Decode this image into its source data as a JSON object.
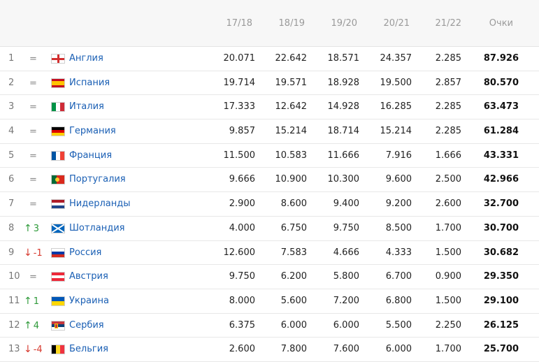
{
  "header": {
    "seasons": [
      "17/18",
      "18/19",
      "19/20",
      "20/21",
      "21/22"
    ],
    "points_label": "Очки"
  },
  "rows": [
    {
      "rank": "1",
      "arrow": "",
      "change": "=",
      "trend": "same",
      "flag": "england-flag-icon",
      "country": "Англия",
      "s1": "20.071",
      "s2": "22.642",
      "s3": "18.571",
      "s4": "24.357",
      "s5": "2.285",
      "total": "87.926"
    },
    {
      "rank": "2",
      "arrow": "",
      "change": "=",
      "trend": "same",
      "flag": "spain-flag-icon",
      "country": "Испания",
      "s1": "19.714",
      "s2": "19.571",
      "s3": "18.928",
      "s4": "19.500",
      "s5": "2.857",
      "total": "80.570"
    },
    {
      "rank": "3",
      "arrow": "",
      "change": "=",
      "trend": "same",
      "flag": "italy-flag-icon",
      "country": "Италия",
      "s1": "17.333",
      "s2": "12.642",
      "s3": "14.928",
      "s4": "16.285",
      "s5": "2.285",
      "total": "63.473"
    },
    {
      "rank": "4",
      "arrow": "",
      "change": "=",
      "trend": "same",
      "flag": "germany-flag-icon",
      "country": "Германия",
      "s1": "9.857",
      "s2": "15.214",
      "s3": "18.714",
      "s4": "15.214",
      "s5": "2.285",
      "total": "61.284"
    },
    {
      "rank": "5",
      "arrow": "",
      "change": "=",
      "trend": "same",
      "flag": "france-flag-icon",
      "country": "Франция",
      "s1": "11.500",
      "s2": "10.583",
      "s3": "11.666",
      "s4": "7.916",
      "s5": "1.666",
      "total": "43.331"
    },
    {
      "rank": "6",
      "arrow": "",
      "change": "=",
      "trend": "same",
      "flag": "portugal-flag-icon",
      "country": "Португалия",
      "s1": "9.666",
      "s2": "10.900",
      "s3": "10.300",
      "s4": "9.600",
      "s5": "2.500",
      "total": "42.966"
    },
    {
      "rank": "7",
      "arrow": "",
      "change": "=",
      "trend": "same",
      "flag": "netherlands-flag-icon",
      "country": "Нидерланды",
      "s1": "2.900",
      "s2": "8.600",
      "s3": "9.400",
      "s4": "9.200",
      "s5": "2.600",
      "total": "32.700"
    },
    {
      "rank": "8",
      "arrow": "↑",
      "change": "3",
      "trend": "up",
      "flag": "scotland-flag-icon",
      "country": "Шотландия",
      "s1": "4.000",
      "s2": "6.750",
      "s3": "9.750",
      "s4": "8.500",
      "s5": "1.700",
      "total": "30.700"
    },
    {
      "rank": "9",
      "arrow": "↓",
      "change": "-1",
      "trend": "down",
      "flag": "russia-flag-icon",
      "country": "Россия",
      "s1": "12.600",
      "s2": "7.583",
      "s3": "4.666",
      "s4": "4.333",
      "s5": "1.500",
      "total": "30.682"
    },
    {
      "rank": "10",
      "arrow": "",
      "change": "=",
      "trend": "same",
      "flag": "austria-flag-icon",
      "country": "Австрия",
      "s1": "9.750",
      "s2": "6.200",
      "s3": "5.800",
      "s4": "6.700",
      "s5": "0.900",
      "total": "29.350"
    },
    {
      "rank": "11",
      "arrow": "↑",
      "change": "1",
      "trend": "up",
      "flag": "ukraine-flag-icon",
      "country": "Украина",
      "s1": "8.000",
      "s2": "5.600",
      "s3": "7.200",
      "s4": "6.800",
      "s5": "1.500",
      "total": "29.100"
    },
    {
      "rank": "12",
      "arrow": "↑",
      "change": "4",
      "trend": "up",
      "flag": "serbia-flag-icon",
      "country": "Сербия",
      "s1": "6.375",
      "s2": "6.000",
      "s3": "6.000",
      "s4": "5.500",
      "s5": "2.250",
      "total": "26.125"
    },
    {
      "rank": "13",
      "arrow": "↓",
      "change": "-4",
      "trend": "down",
      "flag": "belgium-flag-icon",
      "country": "Бельгия",
      "s1": "2.600",
      "s2": "7.800",
      "s3": "7.600",
      "s4": "6.000",
      "s5": "1.700",
      "total": "25.700"
    }
  ],
  "colors": {
    "link": "#1a5fb4",
    "up": "#2f9a3a",
    "down": "#d73a2f",
    "header_bg": "#f7f7f7"
  }
}
